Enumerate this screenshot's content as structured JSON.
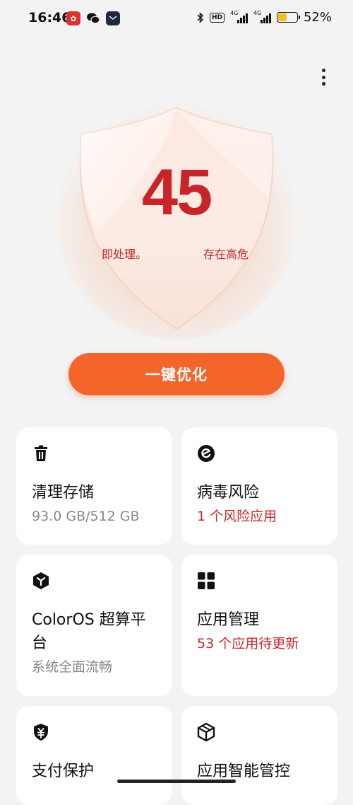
{
  "status_bar": {
    "time": "16:46",
    "hd": "HD",
    "signal1": "4G",
    "signal2": "4G",
    "battery_percent": "52%",
    "battery_level": 0.52
  },
  "shield": {
    "score": "45",
    "ticker_left": "即处理。",
    "ticker_right": "存在高危"
  },
  "optimize_button": "一键优化",
  "cards": [
    {
      "title": "清理存储",
      "subtitle": "93.0 GB/512 GB",
      "icon": "trash-icon"
    },
    {
      "title": "病毒风险",
      "subtitle": "1 个风险应用",
      "icon": "virus-scan-icon"
    },
    {
      "title": "ColorOS 超算平台",
      "subtitle": "系统全面流畅",
      "icon": "compute-platform-icon"
    },
    {
      "title": "应用管理",
      "subtitle": "53 个应用待更新",
      "icon": "app-grid-icon"
    },
    {
      "title": "支付保护",
      "subtitle": "",
      "icon": "payment-shield-icon"
    },
    {
      "title": "应用智能管控",
      "subtitle": "",
      "icon": "smart-control-icon"
    }
  ],
  "colors": {
    "accent": "#f4652c",
    "danger": "#c8252a",
    "background": "#f3f3f3"
  }
}
